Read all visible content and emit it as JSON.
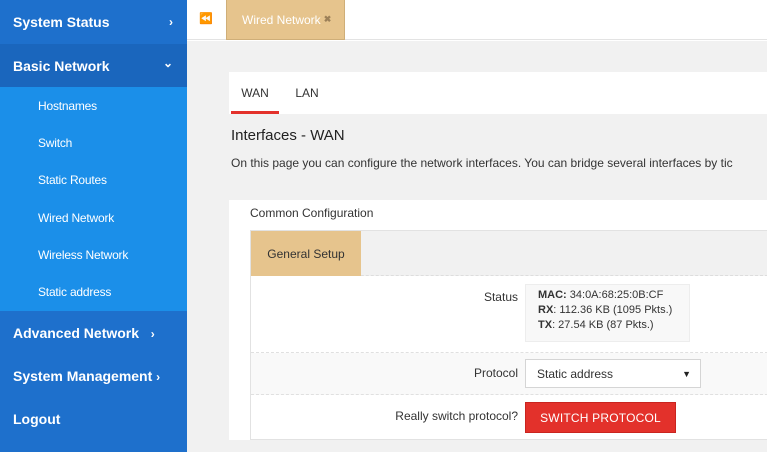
{
  "sidebar": {
    "system_status": "System Status",
    "basic_network": "Basic Network",
    "basic_network_items": [
      "Hostnames",
      "Switch",
      "Static Routes",
      "Wired Network",
      "Wireless Network",
      "Static address"
    ],
    "advanced_network": "Advanced Network",
    "system_management": "System Management",
    "logout": "Logout",
    "chevron_right": "›",
    "chevron_down": "⌄"
  },
  "topbar": {
    "collapse_glyph": "⏪",
    "open_tab_label": "Wired Network",
    "close_glyph": "✖"
  },
  "subtabs": {
    "wan": "WAN",
    "lan": "LAN"
  },
  "page": {
    "title": "Interfaces - WAN",
    "description": "On this page you can configure the network interfaces. You can bridge several interfaces by tic"
  },
  "config": {
    "section_title": "Common Configuration",
    "tab_general": "General Setup",
    "status_label": "Status",
    "mac_label": "MAC:",
    "mac_value": " 34:0A:68:25:0B:CF",
    "rx_label": "RX",
    "rx_value": ": 112.36 KB (1095 Pkts.)",
    "tx_label": "TX",
    "tx_value": ": 27.54 KB (87 Pkts.)",
    "protocol_label": "Protocol",
    "protocol_value": "Static address",
    "protocol_caret": "▼",
    "switch_label": "Really switch protocol?",
    "switch_button": "SWITCH PROTOCOL"
  },
  "colors": {
    "sidebar_bg": "#1e70cc",
    "submenu_bg": "#1b8fe9",
    "tab_accent": "#e6c48d",
    "danger": "#e3312b"
  }
}
